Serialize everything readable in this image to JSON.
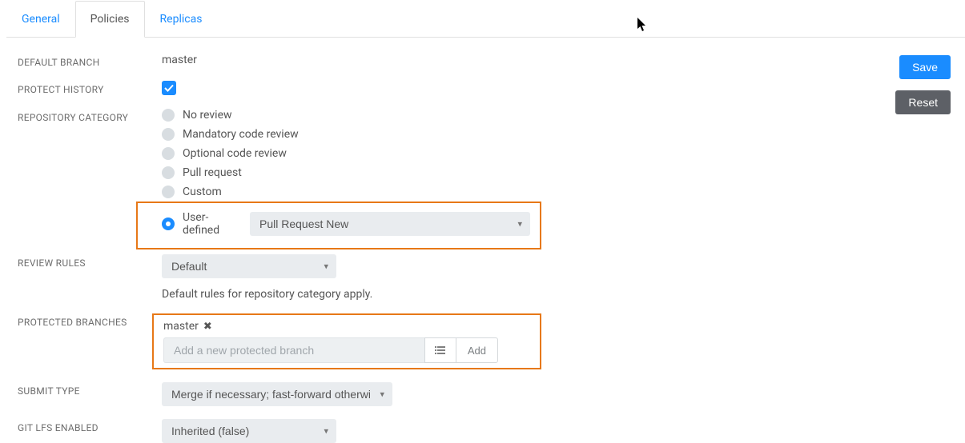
{
  "tabs": {
    "general": "General",
    "policies": "Policies",
    "replicas": "Replicas"
  },
  "labels": {
    "default_branch": "Default Branch",
    "protect_history": "Protect History",
    "repository_category": "Repository Category",
    "review_rules": "Review Rules",
    "protected_branches": "Protected Branches",
    "submit_type": "Submit Type",
    "git_lfs_enabled": "Git LFS Enabled"
  },
  "values": {
    "default_branch": "master",
    "protect_history_checked": true,
    "review_rules_select": "Default",
    "review_rules_hint": "Default rules for repository category apply.",
    "protected_branch_tag": "master",
    "add_branch_placeholder": "Add a new protected branch",
    "add_button": "Add",
    "submit_type_select": "Merge if necessary; fast-forward otherwise",
    "git_lfs_select": "Inherited (false)",
    "user_defined_select": "Pull Request New"
  },
  "category_options": {
    "no_review": "No review",
    "mandatory": "Mandatory code review",
    "optional": "Optional code review",
    "pull_request": "Pull request",
    "custom": "Custom",
    "user_defined": "User-defined"
  },
  "buttons": {
    "save": "Save",
    "reset": "Reset"
  }
}
